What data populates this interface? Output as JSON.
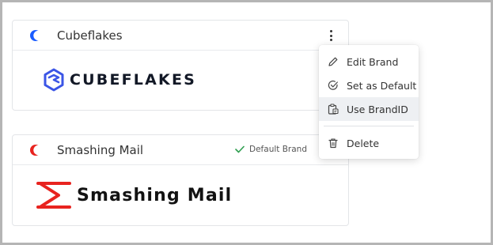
{
  "brands": [
    {
      "name": "Cubeflakes",
      "logo_text": "CUBEFLAKES",
      "icon": "moon-icon",
      "icon_color": "#1a5cff",
      "is_default": false
    },
    {
      "name": "Smashing Mail",
      "logo_text": "Smashing Mail",
      "icon": "moon-icon",
      "icon_color": "#e8231f",
      "is_default": true,
      "default_label": "Default Brand"
    }
  ],
  "menu": {
    "items": [
      {
        "label": "Edit Brand",
        "icon": "pencil-icon"
      },
      {
        "label": "Set as Default",
        "icon": "check-circle-icon"
      },
      {
        "label": "Use BrandID",
        "icon": "clipboard-id-icon"
      },
      {
        "label": "Delete",
        "icon": "trash-icon"
      }
    ]
  },
  "colors": {
    "check": "#2e9e4f",
    "cube_logo": "#3b55e6",
    "smashing_logo": "#e8231f"
  }
}
